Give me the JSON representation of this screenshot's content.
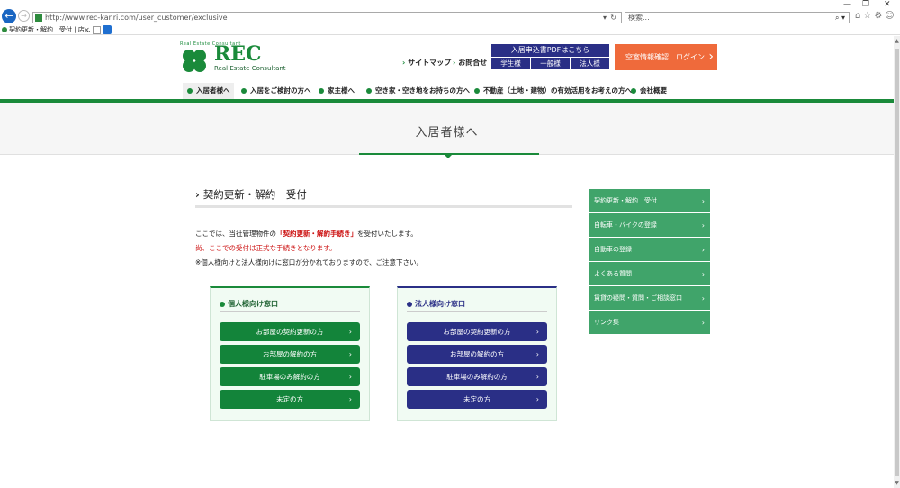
{
  "browser": {
    "url": "http://www.rec-kanri.com/user_customer/exclusive",
    "search_placeholder": "検索...",
    "tab_title": "契約更新・解約　受付 | 店...",
    "window_controls": [
      "—",
      "❐",
      "✕"
    ]
  },
  "header": {
    "logo_arc": "Real Estate Consultant",
    "logo_text": "REC",
    "logo_subtitle": "Real Estate Consultant",
    "links": [
      {
        "label": "サイトマップ"
      },
      {
        "label": "お問合せ"
      }
    ],
    "pdf": {
      "title": "入居申込書PDFはこちら",
      "buttons": [
        "学生様",
        "一般様",
        "法人様"
      ]
    },
    "login_label": "空室情報確認　ログイン"
  },
  "nav": {
    "items": [
      {
        "label": "入居者様へ"
      },
      {
        "label": "入居をご検討の方へ"
      },
      {
        "label": "家主様へ"
      },
      {
        "label": "空き家・空き地をお持ちの方へ"
      },
      {
        "label": "不動産（土地・建物）の有効活用をお考えの方へ"
      },
      {
        "label": "会社概要"
      }
    ]
  },
  "banner": {
    "title": "入居者様へ"
  },
  "main": {
    "section_title": "契約更新・解約　受付",
    "intro_line1_a": "ここでは、当社管理物件の",
    "intro_line1_hl": "「契約更新・解約手続き」",
    "intro_line1_b": "を受付いたします。",
    "intro_line2": "尚、ここでの受付は正式な手続きとなります。",
    "intro_line3": "※個人様向けと法人様向けに窓口が分かれておりますので、ご注意下さい。"
  },
  "boxes": {
    "individual": {
      "title": "個人様向け窓口",
      "buttons": [
        "お部屋の契約更新の方",
        "お部屋の解約の方",
        "駐車場のみ解約の方",
        "未定の方"
      ]
    },
    "corporate": {
      "title": "法人様向け窓口",
      "buttons": [
        "お部屋の契約更新の方",
        "お部屋の解約の方",
        "駐車場のみ解約の方",
        "未定の方"
      ]
    }
  },
  "sidebar": {
    "items": [
      {
        "label": "契約更新・解約　受付"
      },
      {
        "label": "自転車・バイクの登録"
      },
      {
        "label": "自動車の登録"
      },
      {
        "label": "よくある質問"
      },
      {
        "label": "賃貸の疑問・質問・ご相談窓口"
      },
      {
        "label": "リンク集"
      }
    ]
  },
  "colors": {
    "brand_green": "#1a8a3a",
    "navy": "#2a2f86",
    "orange": "#ef6a3b",
    "sidebar_green": "#40a46a",
    "alert_red": "#cc1010"
  }
}
